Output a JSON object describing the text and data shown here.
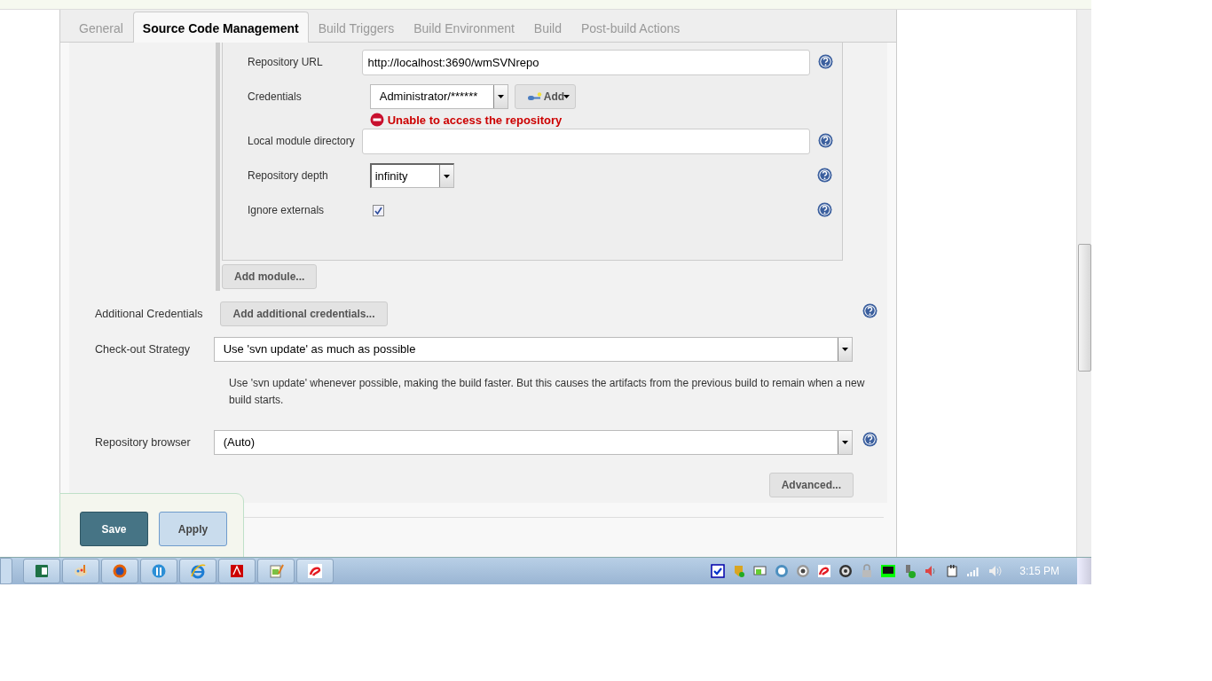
{
  "tabs": [
    {
      "label": "General",
      "selected": false
    },
    {
      "label": "Source Code Management",
      "selected": true
    },
    {
      "label": "Build Triggers",
      "selected": false
    },
    {
      "label": "Build Environment",
      "selected": false
    },
    {
      "label": "Build",
      "selected": false
    },
    {
      "label": "Post-build Actions",
      "selected": false
    }
  ],
  "module_fields": [
    {
      "kind": "text",
      "label": "Repository URL",
      "value": "http://localhost:3690/wmSVNrepo",
      "help": true
    },
    {
      "kind": "credentials",
      "label": "Credentials",
      "value": "Administrator/******",
      "add_button": "Add",
      "error": "Unable to access the repository",
      "help": false
    },
    {
      "kind": "text",
      "label": "Local module directory",
      "help": true
    },
    {
      "kind": "select",
      "label": "Repository depth",
      "value": "infinity",
      "help": true
    },
    {
      "kind": "checkbox",
      "label": "Ignore externals",
      "checked": true,
      "help": true
    }
  ],
  "add_module_button": "Add module...",
  "additional_credentials": {
    "label": "Additional Credentials",
    "button": "Add additional credentials...",
    "help": true
  },
  "checkout_strategy": {
    "label": "Check-out Strategy",
    "value": "Use 'svn update' as much as possible",
    "description": "Use 'svn update' whenever possible, making the build faster. But this causes the artifacts from the previous build to remain when a new build starts.",
    "help": false
  },
  "repository_browser": {
    "label": "Repository browser",
    "value": "(Auto)",
    "help": true
  },
  "advanced_button": "Advanced...",
  "buttons": [
    {
      "label": "Save",
      "kind": "primary"
    },
    {
      "label": "Apply",
      "kind": "secondary"
    }
  ],
  "taskbar": {
    "clock": "3:15 PM"
  }
}
